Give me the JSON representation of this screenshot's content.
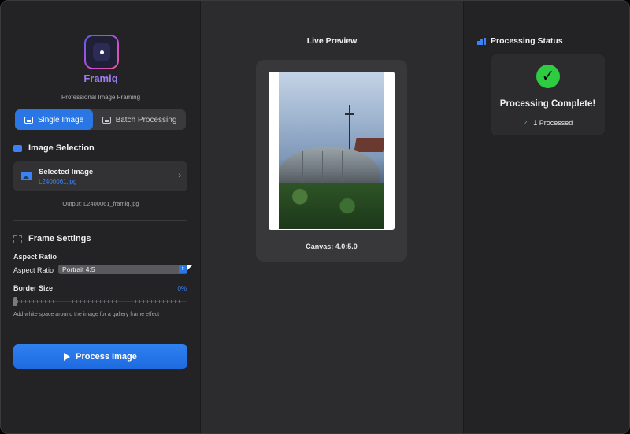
{
  "app": {
    "name": "Framiq",
    "tagline": "Professional Image Framing"
  },
  "mode_tabs": [
    {
      "label": "Single Image",
      "active": true,
      "icon": "photo-icon"
    },
    {
      "label": "Batch Processing",
      "active": false,
      "icon": "stack-icon"
    }
  ],
  "image_selection": {
    "title": "Image Selection",
    "card_title": "Selected Image",
    "file_name": "L2400061.jpg",
    "chevron": "›",
    "output": "Output: L2400061_framiq.jpg"
  },
  "frame_settings": {
    "title": "Frame Settings",
    "aspect_heading": "Aspect Ratio",
    "aspect_label": "Aspect Ratio",
    "aspect_value": "Portrait 4:5",
    "border_label": "Border Size",
    "border_value": "0%",
    "border_fraction": 0,
    "hint": "Add white space around the image for a gallery frame effect"
  },
  "process_button": "Process Image",
  "preview": {
    "title": "Live Preview",
    "canvas": "Canvas: 4.0:5.0"
  },
  "status": {
    "title": "Processing Status",
    "headline": "Processing Complete!",
    "processed": "1 Processed"
  },
  "colors": {
    "accent": "#2b76e5",
    "success": "#2ecc40",
    "brand": "#9d7cf0"
  }
}
